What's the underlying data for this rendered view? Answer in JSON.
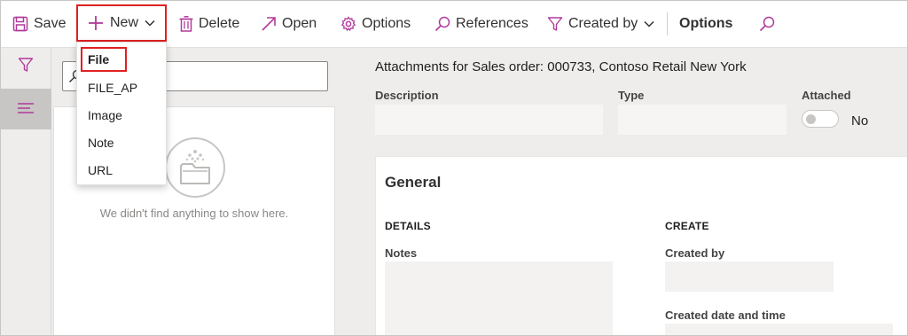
{
  "toolbar": {
    "save_label": "Save",
    "new_label": "New",
    "delete_label": "Delete",
    "open_label": "Open",
    "options_label": "Options",
    "references_label": "References",
    "created_by_label": "Created by",
    "options_tab_label": "Options"
  },
  "new_menu": {
    "items": [
      {
        "label": "File",
        "highlighted": true
      },
      {
        "label": "FILE_AP"
      },
      {
        "label": "Image"
      },
      {
        "label": "Note"
      },
      {
        "label": "URL"
      }
    ]
  },
  "list": {
    "search_placeholder": "",
    "empty_message": "We didn't find anything to show here."
  },
  "detail": {
    "title": "Attachments for Sales order: 000733, Contoso Retail New York",
    "description_label": "Description",
    "type_label": "Type",
    "attached_label": "Attached",
    "attached_value": "No",
    "general": {
      "title": "General",
      "details_heading": "DETAILS",
      "notes_label": "Notes",
      "create_heading": "CREATE",
      "created_by_label": "Created by",
      "created_datetime_label": "Created date and time"
    }
  },
  "colors": {
    "accent": "#b03a9b",
    "highlight_border": "#e02020"
  }
}
